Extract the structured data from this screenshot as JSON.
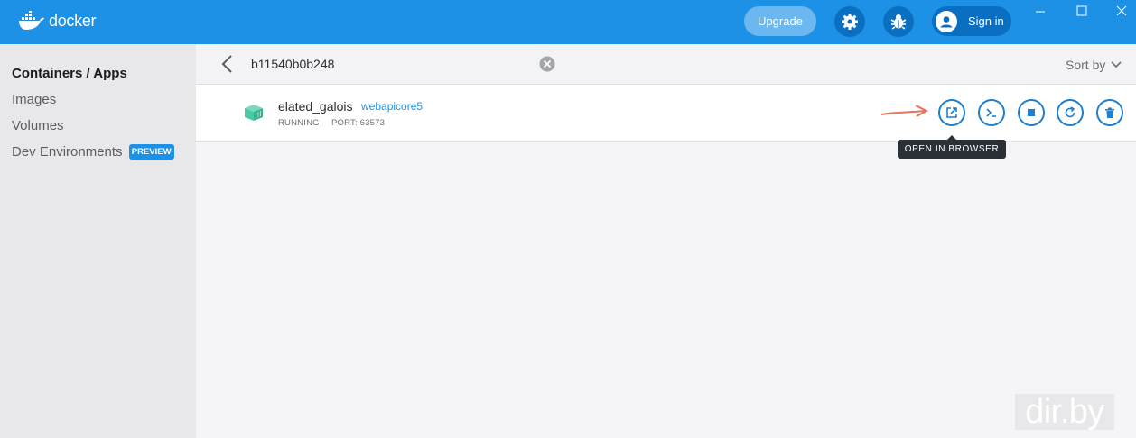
{
  "app": {
    "name": "docker"
  },
  "titlebar": {
    "upgrade_label": "Upgrade",
    "signin_label": "Sign in"
  },
  "sidebar": {
    "items": [
      {
        "label": "Containers / Apps",
        "active": true
      },
      {
        "label": "Images"
      },
      {
        "label": "Volumes"
      },
      {
        "label": "Dev Environments",
        "badge": "PREVIEW"
      }
    ]
  },
  "search": {
    "value": "b11540b0b248"
  },
  "sort": {
    "label": "Sort by"
  },
  "container": {
    "name": "elated_galois",
    "image": "webapicore5",
    "status": "RUNNING",
    "port": "PORT: 63573"
  },
  "tooltip": {
    "text": "OPEN IN BROWSER"
  },
  "watermark": {
    "text": "dir.by"
  },
  "colors": {
    "brand": "#1d91e5",
    "accent": "#1d7fce",
    "cube": "#4dc8a6",
    "annotation_arrow": "#e8735a"
  }
}
